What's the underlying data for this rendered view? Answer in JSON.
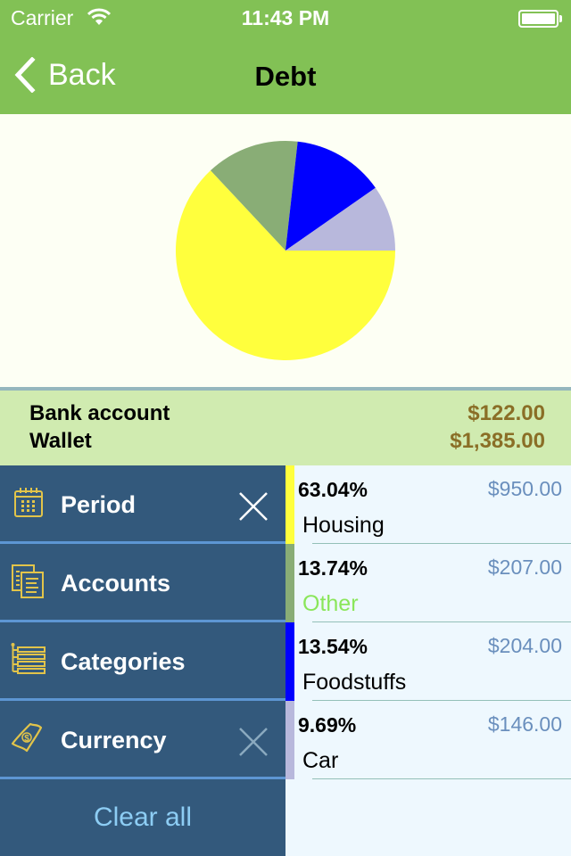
{
  "status_bar": {
    "carrier": "Carrier",
    "wifi_icon": "wifi-icon",
    "time": "11:43 PM",
    "battery_icon": "battery-full-icon"
  },
  "nav": {
    "back_label": "Back",
    "back_icon": "chevron-left-icon",
    "title": "Debt"
  },
  "colors": {
    "nav_bar": "#82c155",
    "sidebar": "#33597c",
    "sidebar_divider": "#5d96d3",
    "icon_gold": "#e2c44a",
    "account_amount": "#8a6e26",
    "list_amount": "#6a8fbd",
    "clear_all_text": "#8dcdf4"
  },
  "accounts": [
    {
      "name": "Bank account",
      "amount": "$122.00"
    },
    {
      "name": "Wallet",
      "amount": "$1,385.00"
    }
  ],
  "filters": [
    {
      "label": "Period",
      "icon": "calendar-icon",
      "clearable": true,
      "clear_enabled": true
    },
    {
      "label": "Accounts",
      "icon": "documents-icon",
      "clearable": false
    },
    {
      "label": "Categories",
      "icon": "category-tree-icon",
      "clearable": false
    },
    {
      "label": "Currency",
      "icon": "banknote-icon",
      "clearable": true,
      "clear_enabled": false
    }
  ],
  "clear_all_label": "Clear all",
  "categories": [
    {
      "percent": "63.04%",
      "amount": "$950.00",
      "name": "Housing",
      "color": "#ffff3d",
      "name_color": "#000000"
    },
    {
      "percent": "13.74%",
      "amount": "$207.00",
      "name": "Other",
      "color": "#89ad76",
      "name_color": "#8ae65a"
    },
    {
      "percent": "13.54%",
      "amount": "$204.00",
      "name": "Foodstuffs",
      "color": "#0000ff",
      "name_color": "#000000"
    },
    {
      "percent": "9.69%",
      "amount": "$146.00",
      "name": "Car",
      "color": "#b8b8dc",
      "name_color": "#000000"
    }
  ],
  "chart_data": {
    "type": "pie",
    "title": "",
    "start_angle": "3 o'clock",
    "direction": "counter-clockwise",
    "categories": [
      "Housing",
      "Other",
      "Foodstuffs",
      "Car"
    ],
    "values": [
      63.04,
      13.74,
      13.54,
      9.69
    ],
    "amounts": [
      950.0,
      207.0,
      204.0,
      146.0
    ],
    "colors": [
      "#ffff3d",
      "#89ad76",
      "#0000ff",
      "#b8b8dc"
    ],
    "legend": "none (list below)"
  }
}
